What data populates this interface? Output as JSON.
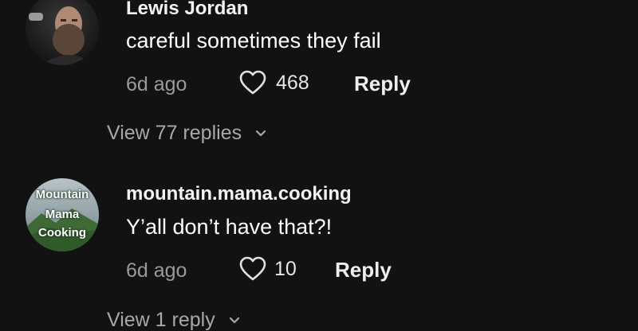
{
  "comments": [
    {
      "username": "Lewis Jordan",
      "text": "careful sometimes they fail",
      "timestamp": "6d ago",
      "likes": "468",
      "reply_label": "Reply",
      "view_replies_label": "View 77 replies"
    },
    {
      "username": "mountain.mama.cooking",
      "text": "Y’all don’t have that?!",
      "timestamp": "6d ago",
      "likes": "10",
      "reply_label": "Reply",
      "view_replies_label": "View 1 reply",
      "avatar_text": [
        "Mountain",
        "Mama",
        "Cooking"
      ]
    }
  ],
  "icons": {
    "like": "heart-outline-icon",
    "expand": "chevron-down-icon"
  },
  "colors": {
    "background": "#121212",
    "text_primary": "#ffffff",
    "text_secondary": "#9a9a9a"
  }
}
